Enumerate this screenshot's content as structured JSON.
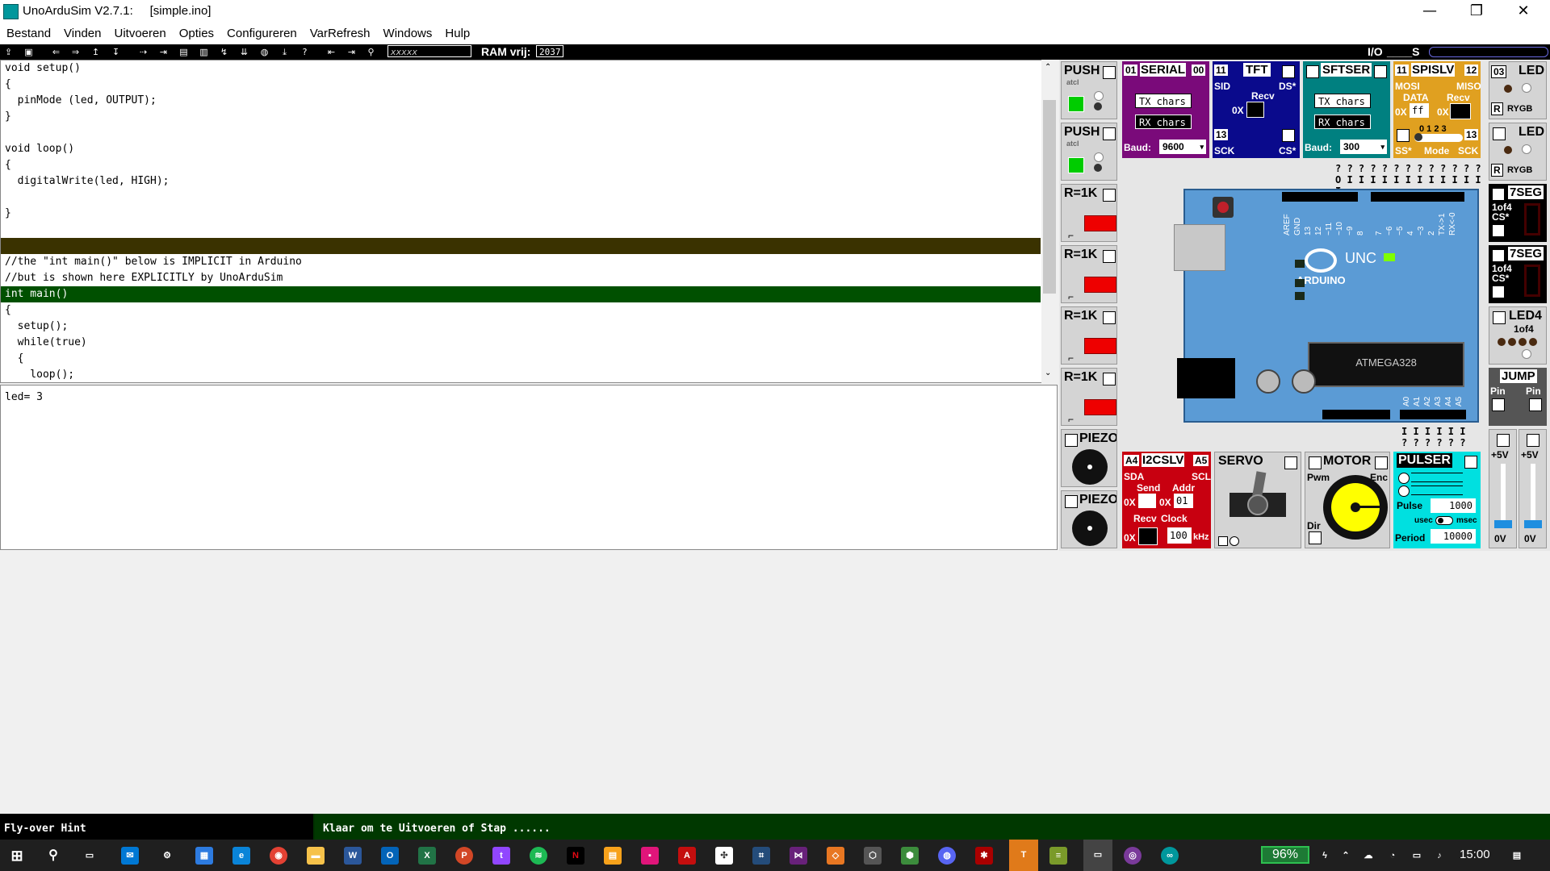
{
  "window": {
    "app_title": "UnoArduSim V2.7.1:",
    "file": "[simple.ino]",
    "min": "—",
    "max": "❐",
    "close": "✕"
  },
  "menu": [
    "Bestand",
    "Vinden",
    "Uitvoeren",
    "Opties",
    "Configureren",
    "VarRefresh",
    "Windows",
    "Hulp"
  ],
  "toolbar": {
    "search_placeholder": "xxxxx",
    "ram_label": "RAM vrij:",
    "ram_value": "2037",
    "io_label": "I/O",
    "io_value": "____S"
  },
  "code_lines": [
    {
      "text": "void setup()",
      "hl": ""
    },
    {
      "text": "{",
      "hl": ""
    },
    {
      "text": "  pinMode (led, OUTPUT);",
      "hl": ""
    },
    {
      "text": "}",
      "hl": ""
    },
    {
      "text": "",
      "hl": ""
    },
    {
      "text": "void loop()",
      "hl": ""
    },
    {
      "text": "{",
      "hl": ""
    },
    {
      "text": "  digitalWrite(led, HIGH);",
      "hl": ""
    },
    {
      "text": "",
      "hl": ""
    },
    {
      "text": "}",
      "hl": ""
    },
    {
      "text": "",
      "hl": ""
    },
    {
      "text": "",
      "hl": "olive"
    },
    {
      "text": "//the \"int main()\" below is IMPLICIT in Arduino",
      "hl": ""
    },
    {
      "text": "//but is shown here EXPLICITLY by UnoArduSim",
      "hl": ""
    },
    {
      "text": "int main()",
      "hl": "green"
    },
    {
      "text": "{",
      "hl": ""
    },
    {
      "text": "  setup();",
      "hl": ""
    },
    {
      "text": "  while(true)",
      "hl": ""
    },
    {
      "text": "  {",
      "hl": ""
    },
    {
      "text": "    loop();",
      "hl": ""
    }
  ],
  "variables": {
    "text": "led= 3"
  },
  "devices": {
    "push": "PUSH",
    "push_sub": "atcl",
    "resistor": "R=1K",
    "piezo": "PIEZO",
    "serial": {
      "label": "SERIAL",
      "pin_a": "01",
      "pin_b": "00",
      "tx": "TX chars",
      "rx": "RX chars",
      "baud_label": "Baud:",
      "baud": "9600"
    },
    "tft": {
      "label": "TFT",
      "pin_a": "11",
      "sid": "SID",
      "ds": "DS*",
      "recv": "Recv",
      "hex": "0X",
      "sck_pin": "13",
      "sck": "SCK",
      "cs": "CS*"
    },
    "sftser": {
      "label": "SFTSER",
      "tx": "TX chars",
      "rx": "RX chars",
      "baud_label": "Baud:",
      "baud": "300"
    },
    "spislv": {
      "label": "SPISLV",
      "pin_a": "11",
      "pin_b": "12",
      "mosi": "MOSI",
      "miso": "MISO",
      "data": "DATA",
      "recv": "Recv",
      "hex_a": "0X",
      "val": "ff",
      "hex_b": "0X",
      "modes": "0 1 2 3",
      "ss": "SS*",
      "mode": "Mode",
      "sck": "SCK",
      "pin_c": "13"
    },
    "led": {
      "label": "LED",
      "pin": "03",
      "r": "R",
      "rygb": "RYGB"
    },
    "seg7": {
      "label": "7SEG",
      "sub": "1of4",
      "cs": "CS*"
    },
    "led4": {
      "label": "LED4",
      "sub": "1of4"
    },
    "jump": {
      "label": "JUMP",
      "pin": "Pin"
    },
    "i2cslv": {
      "label": "I2CSLV",
      "pin_a": "A4",
      "pin_b": "A5",
      "sda": "SDA",
      "scl": "SCL",
      "send": "Send",
      "addr": "Addr",
      "hex": "0X",
      "addr_val": "01",
      "recv": "Recv",
      "clock": "Clock",
      "clock_val": "100",
      "khz": "kHz"
    },
    "servo": {
      "label": "SERVO"
    },
    "motor": {
      "label": "MOTOR",
      "pwm": "Pwm",
      "enc": "Enc",
      "dir": "Dir"
    },
    "pulser": {
      "label": "PULSER",
      "pulse": "Pulse",
      "pulse_val": "1000",
      "usec": "usec",
      "msec": "msec",
      "period": "Period",
      "period_val": "10000"
    },
    "volt": {
      "top": "+5V",
      "bottom": "0V"
    }
  },
  "board": {
    "logo": "ARDUINO",
    "unc": "UNC",
    "chip": "ATMEGA328",
    "digital_labels": [
      "AREF",
      "GND",
      "13",
      "12",
      "~11",
      "~10",
      "~9",
      "8",
      "7",
      "~6",
      "~5",
      "4",
      "~3",
      "2",
      "TX->1",
      "RX<-0"
    ],
    "analog_labels": [
      "A0",
      "A1",
      "A2",
      "A3",
      "A4",
      "A5"
    ],
    "top_pins_q": "? ? ? ? ? ? ? ? ? ? ? ? ?",
    "top_pins_i": "O I I I I I I I I I I I I I",
    "bottom_pins_i": "I I I I I I",
    "bottom_pins_q": "? ? ? ? ? ?"
  },
  "status": {
    "hint": "Fly-over Hint",
    "message": "Klaar om te Uitvoeren of Stap ......"
  },
  "taskbar": {
    "battery": "96%",
    "clock": "15:00"
  },
  "colors": {
    "code_olive": "#3a3200",
    "code_green": "#005000",
    "serial_bg": "#7a0a7a",
    "tft_bg": "#0a0a8c",
    "sftser_bg": "#008080",
    "spislv_bg": "#e0a020",
    "i2c_bg": "#c80010",
    "pulser_bg": "#00e0e0",
    "board": "#5b9bd5"
  }
}
